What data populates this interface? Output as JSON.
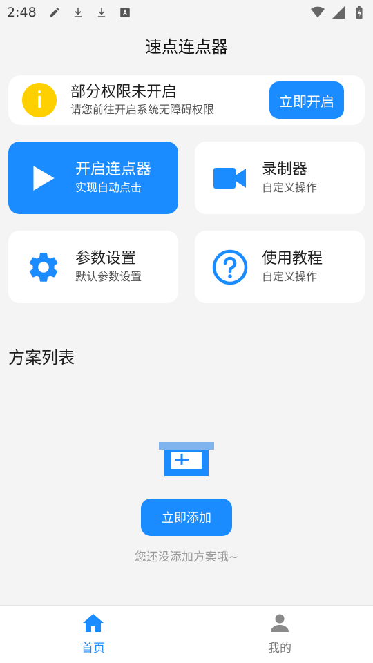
{
  "status_bar": {
    "time": "2:48",
    "left_icons": [
      "pencil-icon",
      "download-icon",
      "download-icon",
      "font-a-icon"
    ],
    "right_icons": [
      "wifi-icon",
      "signal-icon",
      "battery-charging-icon"
    ]
  },
  "app": {
    "title": "速点连点器"
  },
  "permission_card": {
    "title": "部分权限未开启",
    "subtitle": "请您前往开启系统无障碍权限",
    "button_label": "立即开启",
    "icon": "info-icon"
  },
  "tiles": [
    {
      "title": "开启连点器",
      "subtitle": "实现自动点击",
      "icon": "play-icon",
      "active": true
    },
    {
      "title": "录制器",
      "subtitle": "自定义操作",
      "icon": "video-camera-icon",
      "active": false
    },
    {
      "title": "参数设置",
      "subtitle": "默认参数设置",
      "icon": "gear-icon",
      "active": false
    },
    {
      "title": "使用教程",
      "subtitle": "自定义操作",
      "icon": "help-icon",
      "active": false
    }
  ],
  "plans": {
    "section_title": "方案列表",
    "empty_icon": "add-box-icon",
    "add_button_label": "立即添加",
    "empty_hint": "您还没添加方案哦~"
  },
  "bottom_nav": {
    "items": [
      {
        "label": "首页",
        "icon": "home-icon",
        "active": true
      },
      {
        "label": "我的",
        "icon": "person-icon",
        "active": false
      }
    ]
  },
  "colors": {
    "accent": "#1a8cff",
    "warning": "#ffd000",
    "background": "#f4f4f4"
  }
}
